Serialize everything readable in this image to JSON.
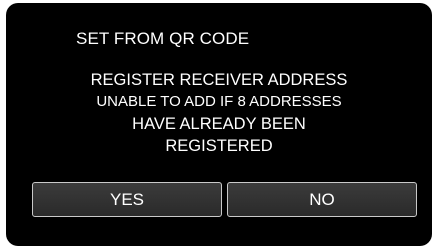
{
  "dialog": {
    "title": "SET FROM QR CODE",
    "message_lines": [
      "REGISTER RECEIVER ADDRESS",
      "UNABLE TO ADD IF 8 ADDRESSES",
      "HAVE ALREADY BEEN",
      "REGISTERED"
    ],
    "yes_label": "YES",
    "no_label": "NO"
  },
  "colors": {
    "screen_background": "#000000",
    "text": "#ffffff",
    "button_background": "#333333",
    "button_border": "#c9c9c9"
  }
}
